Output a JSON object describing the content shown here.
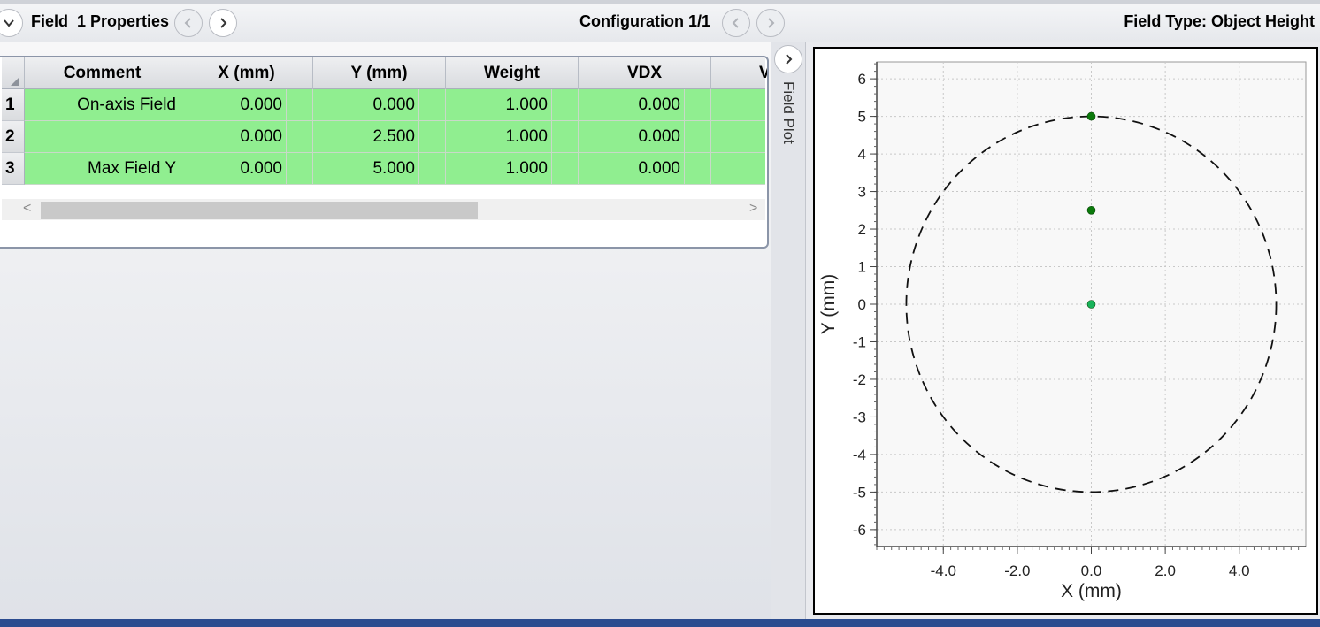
{
  "toolbar": {
    "title": "Field  1 Properties",
    "configuration": "Configuration 1/1",
    "field_type": "Field Type: Object Height"
  },
  "table": {
    "headers": [
      "Comment",
      "X (mm)",
      "Y (mm)",
      "Weight",
      "VDX",
      "V"
    ],
    "rows": [
      {
        "num": "1",
        "comment": "On-axis Field",
        "x": "0.000",
        "y": "0.000",
        "weight": "1.000",
        "vdx": "0.000"
      },
      {
        "num": "2",
        "comment": "",
        "x": "0.000",
        "y": "2.500",
        "weight": "1.000",
        "vdx": "0.000"
      },
      {
        "num": "3",
        "comment": "Max Field Y",
        "x": "0.000",
        "y": "5.000",
        "weight": "1.000",
        "vdx": "0.000"
      }
    ],
    "scroll_left": "<",
    "scroll_right": ">",
    "scroll_position": 0.0
  },
  "side_panel": {
    "label": "Field Plot"
  },
  "colors": {
    "row_fill": "#90ee90",
    "point_dark": "#0b7a0b",
    "point_light": "#18b35a",
    "status_bar": "#2b4c8f"
  },
  "chart_data": {
    "type": "scatter",
    "xlabel": "X (mm)",
    "ylabel": "Y (mm)",
    "xlim": [
      -5.8,
      5.8
    ],
    "ylim": [
      -6.45,
      6.45
    ],
    "x_ticks": [
      -4.0,
      -2.0,
      0.0,
      2.0,
      4.0
    ],
    "x_tick_labels": [
      "-4.0",
      "-2.0",
      "0.0",
      "2.0",
      "4.0"
    ],
    "y_ticks": [
      6,
      5,
      4,
      3,
      2,
      1,
      0,
      -1,
      -2,
      -3,
      -4,
      -5,
      -6
    ],
    "y_tick_labels": [
      "6",
      "5",
      "4",
      "3",
      "2",
      "1",
      "0",
      "-1",
      "-2",
      "-3",
      "-4",
      "-5",
      "-6"
    ],
    "grid": true,
    "circle_radius": 5.0,
    "points": [
      {
        "x": 0.0,
        "y": 0.0,
        "color": "#18b35a"
      },
      {
        "x": 0.0,
        "y": 2.5,
        "color": "#0b7a0b"
      },
      {
        "x": 0.0,
        "y": 5.0,
        "color": "#0b7a0b"
      }
    ]
  }
}
